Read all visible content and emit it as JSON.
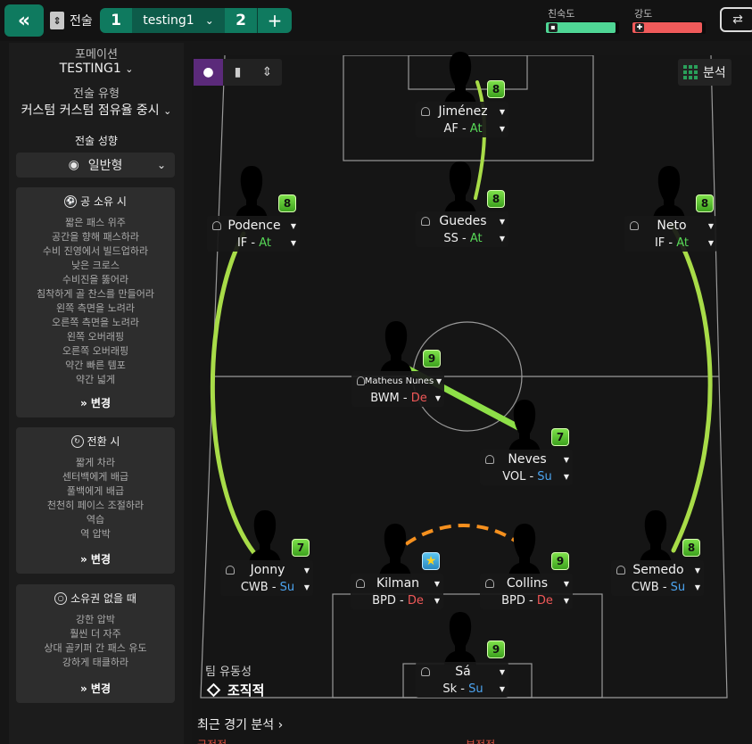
{
  "topbar": {
    "back_label": "«",
    "tactic_icon": "tactic-board-icon",
    "tactic_label": "전술",
    "slot1_num": "1",
    "slot1_name": "testing1",
    "slot2_num": "2",
    "add_label": "+",
    "familiarity_label": "친숙도",
    "familiarity_value": 0.95,
    "familiarity_color": "#4fd695",
    "intensity_label": "강도",
    "intensity_value": 0.95,
    "intensity_color": "#f05a5a",
    "swap_icon": "swap-arrows-icon"
  },
  "left": {
    "formation_label": "포메이션",
    "formation_value": "TESTING1",
    "style_label": "전술 유형",
    "style_value": "커스텀 커스텀 점유율 중시",
    "mentality_label": "전술 성향",
    "mentality_value": "일반형",
    "in_possession": {
      "title": "공 소유 시",
      "items": [
        "짧은 패스 위주",
        "공간을 향해 패스하라",
        "수비 진영에서 빌드업하라",
        "낮은 크로스",
        "수비진을 뚫어라",
        "침착하게 골 찬스를 만들어라",
        "왼쪽 측면을 노려라",
        "오른쪽 측면을 노려라",
        "왼쪽 오버래핑",
        "오른쪽 오버래핑",
        "약간 빠른 템포",
        "약간 넓게"
      ],
      "change": "변경"
    },
    "transition": {
      "title": "전환 시",
      "items": [
        "짧게 차라",
        "센터백에게 배급",
        "풀백에게 배급",
        "천천히 페이스 조절하라",
        "역습",
        "역 압박"
      ],
      "change": "변경"
    },
    "out_of_possession": {
      "title": "소유권 없을 때",
      "items": [
        "강한 압박",
        "훨씬 더 자주",
        "상대 골키퍼 간 패스 유도",
        "강하게 태클하라"
      ],
      "change": "변경"
    }
  },
  "pitch": {
    "analysis_label": "분석",
    "fluidity_label": "팀 유동성",
    "fluidity_value": "조직적",
    "players": [
      {
        "key": "jimenez",
        "name": "Jiménez",
        "role": "AF",
        "duty": "At",
        "rating": "8"
      },
      {
        "key": "podence",
        "name": "Podence",
        "role": "IF",
        "duty": "At",
        "rating": "8"
      },
      {
        "key": "guedes",
        "name": "Guedes",
        "role": "SS",
        "duty": "At",
        "rating": "8"
      },
      {
        "key": "neto",
        "name": "Neto",
        "role": "IF",
        "duty": "At",
        "rating": "8"
      },
      {
        "key": "nunes",
        "name": "Matheus Nunes",
        "role": "BWM",
        "duty": "De",
        "rating": "9"
      },
      {
        "key": "neves",
        "name": "Neves",
        "role": "VOL",
        "duty": "Su",
        "rating": "7"
      },
      {
        "key": "jonny",
        "name": "Jonny",
        "role": "CWB",
        "duty": "Su",
        "rating": "7"
      },
      {
        "key": "kilman",
        "name": "Kilman",
        "role": "BPD",
        "duty": "De",
        "rating": "★"
      },
      {
        "key": "collins",
        "name": "Collins",
        "role": "BPD",
        "duty": "De",
        "rating": "9"
      },
      {
        "key": "semedo",
        "name": "Semedo",
        "role": "CWB",
        "duty": "Su",
        "rating": "8"
      },
      {
        "key": "sa",
        "name": "Sá",
        "role": "Sk",
        "duty": "Su",
        "rating": "9"
      }
    ]
  },
  "recent": {
    "title": "최근 경기 분석",
    "positive": "긍정적",
    "negative": "부정적"
  }
}
